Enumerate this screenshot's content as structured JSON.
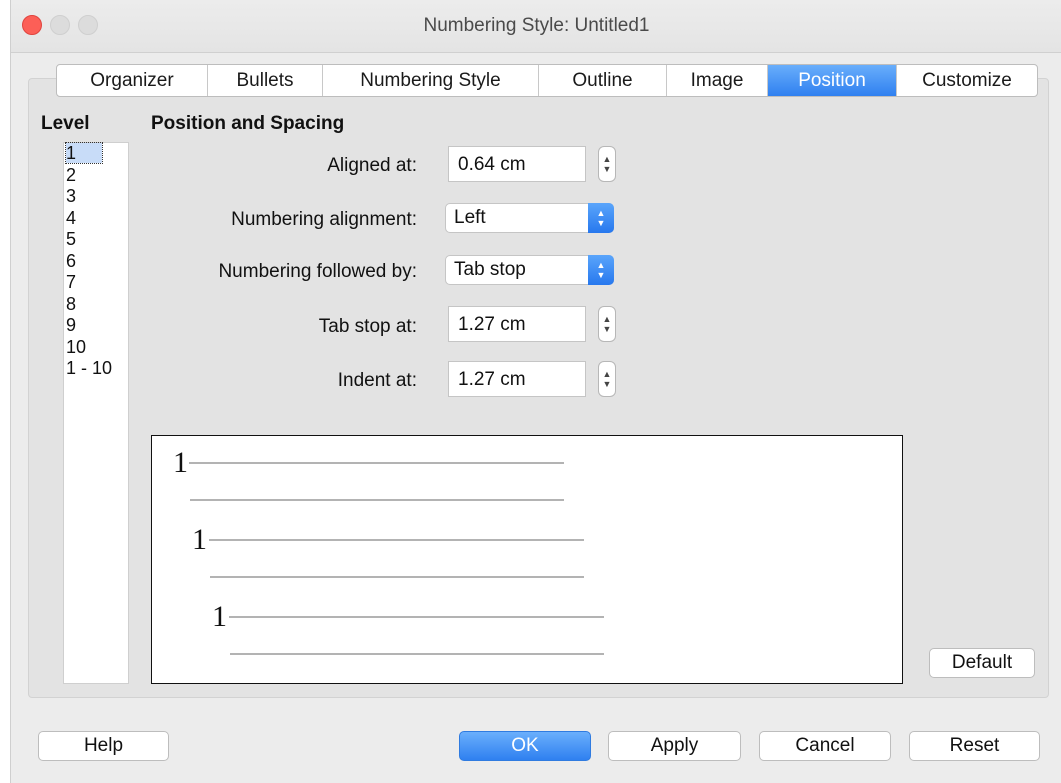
{
  "window": {
    "title": "Numbering Style: Untitled1"
  },
  "tabs": [
    {
      "label": "Organizer"
    },
    {
      "label": "Bullets"
    },
    {
      "label": "Numbering Style"
    },
    {
      "label": "Outline"
    },
    {
      "label": "Image"
    },
    {
      "label": "Position",
      "active": true
    },
    {
      "label": "Customize"
    }
  ],
  "level": {
    "heading": "Level",
    "items": [
      "1",
      "2",
      "3",
      "4",
      "5",
      "6",
      "7",
      "8",
      "9",
      "10",
      "1 - 10"
    ],
    "selected": "1"
  },
  "position": {
    "heading": "Position and Spacing",
    "aligned_at": {
      "label": "Aligned at:",
      "value": "0.64 cm"
    },
    "numbering_alignment": {
      "label": "Numbering alignment:",
      "value": "Left"
    },
    "numbering_followed_by": {
      "label": "Numbering followed by:",
      "value": "Tab stop"
    },
    "tab_stop_at": {
      "label": "Tab stop at:",
      "value": "1.27 cm"
    },
    "indent_at": {
      "label": "Indent at:",
      "value": "1.27 cm"
    }
  },
  "preview": {
    "numbers": [
      "1",
      "1",
      "1"
    ]
  },
  "buttons": {
    "default": "Default",
    "help": "Help",
    "ok": "OK",
    "apply": "Apply",
    "cancel": "Cancel",
    "reset": "Reset"
  },
  "colors": {
    "accent": "#2f80f0",
    "close": "#fc5f57"
  }
}
